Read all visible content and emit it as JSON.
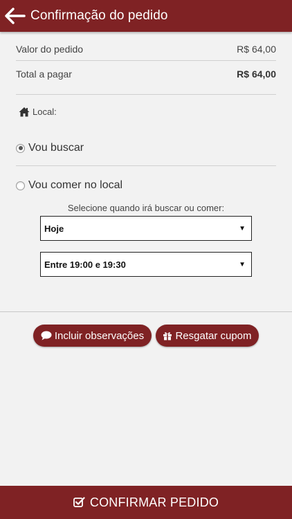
{
  "header": {
    "title": "Confirmação do pedido"
  },
  "summary": {
    "order_value_label": "Valor do pedido",
    "order_value": "R$ 64,00",
    "total_label": "Total a pagar",
    "total_value": "R$ 64,00"
  },
  "local": {
    "label": "Local:",
    "options": [
      {
        "label": "Vou buscar",
        "selected": true
      },
      {
        "label": "Vou comer no local",
        "selected": false
      }
    ]
  },
  "schedule": {
    "prompt": "Selecione quando irá buscar ou comer:",
    "day_selected": "Hoje",
    "time_selected": "Entre 19:00 e 19:30"
  },
  "actions": {
    "notes_label": "Incluir observações",
    "coupon_label": "Resgatar cupom"
  },
  "confirm": {
    "label": "CONFIRMAR PEDIDO"
  },
  "colors": {
    "brand": "#7f2224",
    "background": "#f2f2f2"
  }
}
